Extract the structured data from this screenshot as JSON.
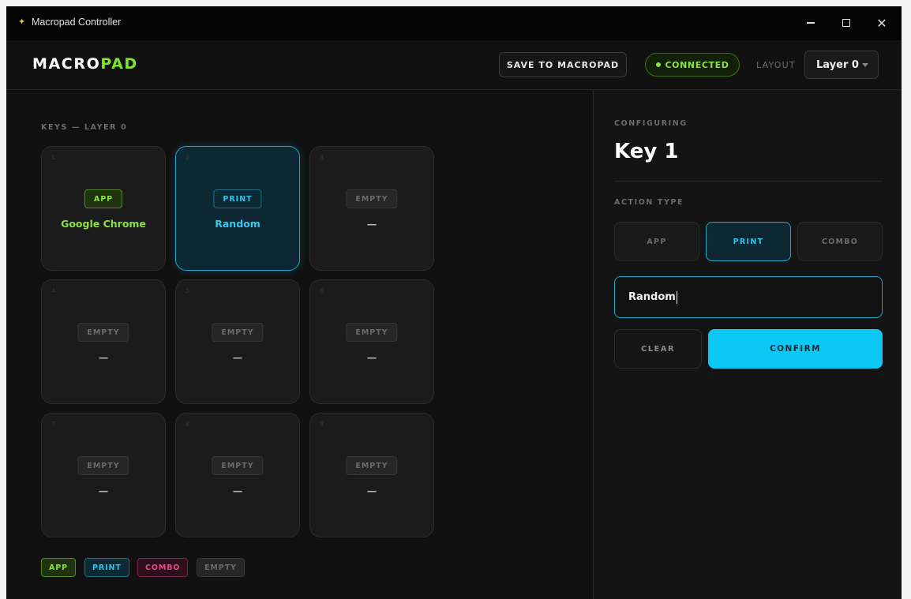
{
  "window": {
    "title": "Macropad Controller",
    "icon": "app-icon",
    "controls": [
      "minimize",
      "maximize",
      "close"
    ]
  },
  "header": {
    "logo_main": "MACRO",
    "logo_accent": "PAD",
    "save_label": "SAVE TO MACROPAD",
    "status_label": "CONNECTED",
    "layout_label": "LAYOUT",
    "layout_value": "Layer 0"
  },
  "keys_section": {
    "label": "KEYS — LAYER 0",
    "keys": [
      {
        "index": "1",
        "tag": "APP",
        "value": "Google Chrome",
        "type": "app"
      },
      {
        "index": "2",
        "tag": "PRINT",
        "value": "Random",
        "type": "print",
        "selected": true
      },
      {
        "index": "3",
        "tag": "EMPTY",
        "value": "—",
        "type": "empty"
      },
      {
        "index": "4",
        "tag": "EMPTY",
        "value": "—",
        "type": "empty"
      },
      {
        "index": "5",
        "tag": "EMPTY",
        "value": "—",
        "type": "empty"
      },
      {
        "index": "6",
        "tag": "EMPTY",
        "value": "—",
        "type": "empty"
      },
      {
        "index": "7",
        "tag": "EMPTY",
        "value": "—",
        "type": "empty"
      },
      {
        "index": "8",
        "tag": "EMPTY",
        "value": "—",
        "type": "empty"
      },
      {
        "index": "9",
        "tag": "EMPTY",
        "value": "—",
        "type": "empty"
      }
    ]
  },
  "legend": [
    "APP",
    "PRINT",
    "COMBO",
    "EMPTY"
  ],
  "config": {
    "section_label": "CONFIGURING",
    "title": "Key 1",
    "action_label": "ACTION TYPE",
    "types": [
      "APP",
      "PRINT",
      "COMBO"
    ],
    "active_type": "PRINT",
    "input_value": "Random",
    "clear_label": "CLEAR",
    "confirm_label": "CONFIRM"
  },
  "colors": {
    "app": "#8be23f",
    "print": "#29c6ef",
    "combo": "#e04a82",
    "empty": "#6b6b6b",
    "confirm": "#0cc8f5"
  }
}
